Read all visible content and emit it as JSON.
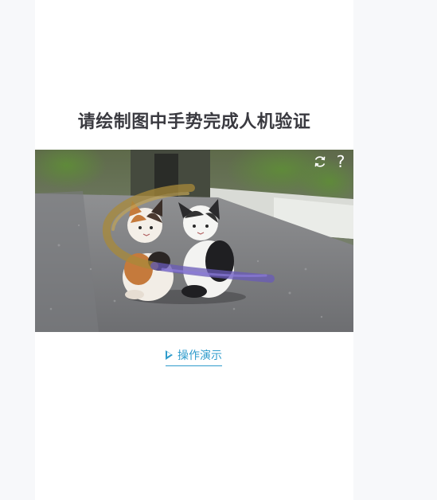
{
  "title": "请绘制图中手势完成人机验证",
  "captcha": {
    "refresh_icon": "refresh-icon",
    "help_icon": "question-mark-icon",
    "help_glyph": "?",
    "gesture_colors": [
      "#a88a3a",
      "#6a5bb8"
    ]
  },
  "demo_link": {
    "icon": "play-outline-icon",
    "label": "操作演示",
    "color": "#2f9ccc"
  }
}
